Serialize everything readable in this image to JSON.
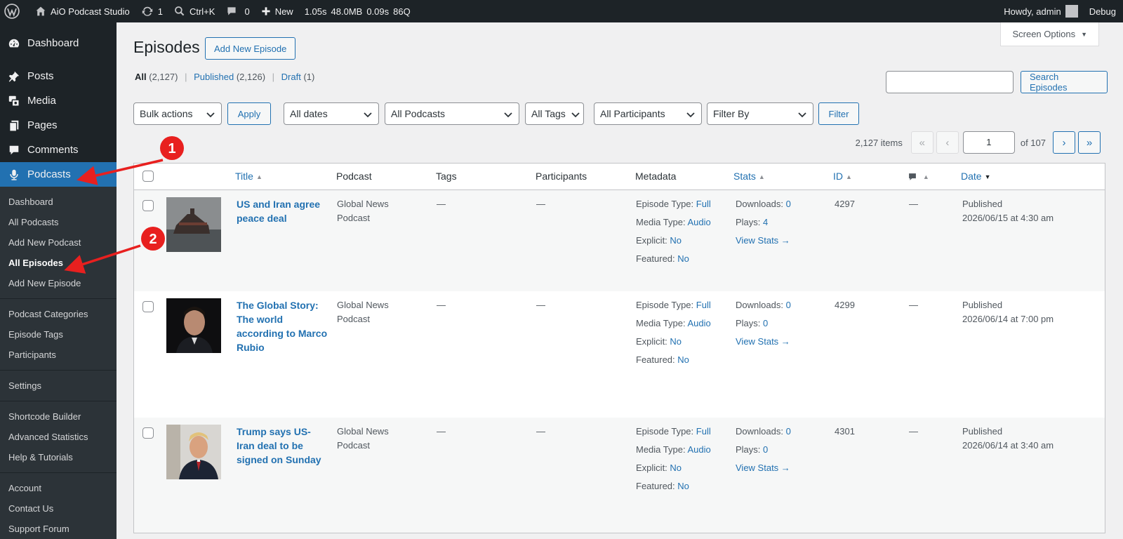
{
  "adminbar": {
    "site_name": "AiO Podcast Studio",
    "updates_count": "1",
    "search_shortcut": "Ctrl+K",
    "comments_count": "0",
    "new_label": "New",
    "perf_time": "1.05s",
    "perf_mem": "48.0MB",
    "perf_query_time": "0.09s",
    "perf_queries": "86Q",
    "howdy": "Howdy, admin",
    "debug": "Debug"
  },
  "sidebar": {
    "top_items": [
      {
        "label": "Dashboard",
        "icon": "dashboard-icon"
      },
      {
        "label": "Posts",
        "icon": "pin-icon"
      },
      {
        "label": "Media",
        "icon": "media-icon"
      },
      {
        "label": "Pages",
        "icon": "pages-icon"
      },
      {
        "label": "Comments",
        "icon": "comment-icon"
      },
      {
        "label": "Podcasts",
        "icon": "microphone-icon"
      }
    ],
    "sub_items": [
      "Dashboard",
      "All Podcasts",
      "Add New Podcast",
      "All Episodes",
      "Add New Episode",
      "Podcast Categories",
      "Episode Tags",
      "Participants",
      "Settings",
      "Shortcode Builder",
      "Advanced Statistics",
      "Help & Tutorials",
      "Account",
      "Contact Us",
      "Support Forum"
    ]
  },
  "screen_options": "Screen Options",
  "page": {
    "title": "Episodes",
    "add_new": "Add New Episode"
  },
  "views": {
    "all": "All",
    "all_count": "(2,127)",
    "published": "Published",
    "published_count": "(2,126)",
    "draft": "Draft",
    "draft_count": "(1)"
  },
  "search": {
    "button": "Search Episodes"
  },
  "filters": {
    "bulk_actions": "Bulk actions",
    "apply": "Apply",
    "dates": "All dates",
    "podcasts": "All Podcasts",
    "tags": "All Tags",
    "participants": "All Participants",
    "filter_by": "Filter By",
    "filter": "Filter"
  },
  "pagination": {
    "items": "2,127 items",
    "first": "«",
    "prev": "‹",
    "current": "1",
    "of": "of 107",
    "next": "›",
    "last": "»"
  },
  "table": {
    "columns": {
      "title": "Title",
      "podcast": "Podcast",
      "tags": "Tags",
      "participants": "Participants",
      "metadata": "Metadata",
      "stats": "Stats",
      "id": "ID",
      "date": "Date"
    },
    "labels": {
      "episode_type": "Episode Type:",
      "media_type": "Media Type:",
      "explicit": "Explicit:",
      "featured": "Featured:",
      "downloads": "Downloads:",
      "plays": "Plays:",
      "view_stats": "View Stats →"
    },
    "rows": [
      {
        "title": "US and Iran agree peace deal",
        "podcast": "Global News Podcast",
        "tags": "—",
        "participants": "—",
        "episode_type": "Full",
        "media_type": "Audio",
        "explicit": "No",
        "featured": "No",
        "downloads": "0",
        "plays": "4",
        "id": "4297",
        "comments": "—",
        "status": "Published",
        "date": "2026/06/15 at 4:30 am"
      },
      {
        "title": "The Global Story: The world according to Marco Rubio",
        "podcast": "Global News Podcast",
        "tags": "—",
        "participants": "—",
        "episode_type": "Full",
        "media_type": "Audio",
        "explicit": "No",
        "featured": "No",
        "downloads": "0",
        "plays": "0",
        "id": "4299",
        "comments": "—",
        "status": "Published",
        "date": "2026/06/14 at 7:00 pm"
      },
      {
        "title": "Trump says US-Iran deal to be signed on Sunday",
        "podcast": "Global News Podcast",
        "tags": "—",
        "participants": "—",
        "episode_type": "Full",
        "media_type": "Audio",
        "explicit": "No",
        "featured": "No",
        "downloads": "0",
        "plays": "0",
        "id": "4301",
        "comments": "—",
        "status": "Published",
        "date": "2026/06/14 at 3:40 am"
      }
    ]
  },
  "annotations": [
    {
      "number": "1"
    },
    {
      "number": "2"
    }
  ],
  "colors": {
    "accent": "#2271b1",
    "admin_dark": "#1d2327",
    "annotation_red": "#e8201f"
  }
}
